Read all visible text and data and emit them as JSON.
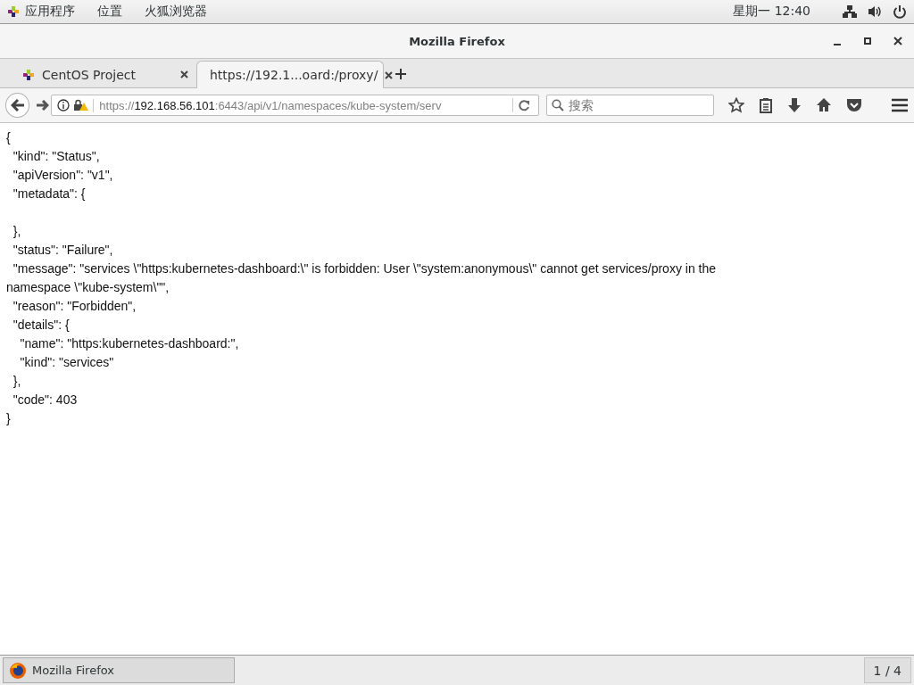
{
  "top_bar": {
    "menus": [
      "应用程序",
      "位置",
      "火狐浏览器"
    ],
    "clock": "星期一 12:40"
  },
  "window": {
    "title": "Mozilla Firefox"
  },
  "tabs": [
    {
      "label": "CentOS Project",
      "selected": false
    },
    {
      "label": "https://192.1...oard:/proxy/",
      "selected": true
    }
  ],
  "address_bar": {
    "scheme": "https://",
    "host": "192.168.56.101",
    "rest": ":6443/api/v1/namespaces/kube-system/serv"
  },
  "search": {
    "placeholder": "搜索"
  },
  "document": {
    "lines": [
      {
        "text": "{"
      },
      {
        "text": "  \"kind\": \"Status\","
      },
      {
        "text": "  \"apiVersion\": \"v1\","
      },
      {
        "text": "  \"metadata\": {"
      },
      {
        "text": "  },",
        "blank_before": true
      },
      {
        "text": "  \"status\": \"Failure\","
      },
      {
        "text": "  \"message\": \"services \\\"https:kubernetes-dashboard:\\\" is forbidden: User \\\"system:anonymous\\\" cannot get services/proxy in the"
      },
      {
        "text": "namespace \\\"kube-system\\\"\","
      },
      {
        "text": "  \"reason\": \"Forbidden\","
      },
      {
        "text": "  \"details\": {"
      },
      {
        "text": "    \"name\": \"https:kubernetes-dashboard:\","
      },
      {
        "text": "    \"kind\": \"services\""
      },
      {
        "text": "  },"
      },
      {
        "text": "  \"code\": 403"
      },
      {
        "text": "}"
      }
    ]
  },
  "taskbar": {
    "window_button": "Mozilla Firefox",
    "workspace": "1 / 4"
  }
}
